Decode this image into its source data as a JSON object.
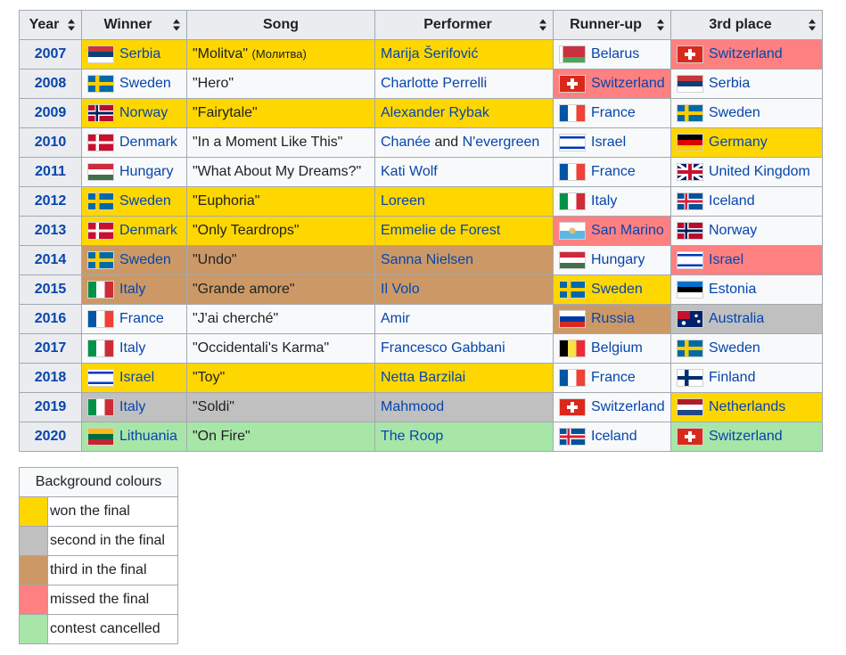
{
  "headers": [
    "Year",
    "Winner",
    "Song",
    "Performer",
    "Runner-up",
    "3rd place"
  ],
  "colors": {
    "gold": "#ffd700",
    "silver": "#c0c0c0",
    "bronze": "#cc9966",
    "missed": "#fe8080",
    "cancelled": "#a8e6a8",
    "plain": "#f8f9fa",
    "header": "#eaecf0",
    "border": "#a2a9b1",
    "link": "#0645ad"
  },
  "rows": [
    {
      "year": "2007",
      "winner": {
        "country": "Serbia",
        "flag": "serbia-flag",
        "bg": "gold"
      },
      "song": {
        "title": "\"Molitva\"",
        "extra": "(Молитва)",
        "bg": "gold"
      },
      "performer": {
        "parts": [
          "Marija Šerifović"
        ],
        "bg": "gold"
      },
      "runner_up": {
        "country": "Belarus",
        "flag": "belarus-flag",
        "bg": "plain"
      },
      "third": {
        "country": "Switzerland",
        "flag": "switzerland-flag",
        "bg": "missed"
      }
    },
    {
      "year": "2008",
      "winner": {
        "country": "Sweden",
        "flag": "sweden-flag",
        "bg": "plain"
      },
      "song": {
        "title": "\"Hero\"",
        "bg": "plain"
      },
      "performer": {
        "parts": [
          "Charlotte Perrelli"
        ],
        "bg": "plain"
      },
      "runner_up": {
        "country": "Switzerland",
        "flag": "switzerland-flag",
        "bg": "missed"
      },
      "third": {
        "country": "Serbia",
        "flag": "serbia-flag",
        "bg": "plain"
      }
    },
    {
      "year": "2009",
      "winner": {
        "country": "Norway",
        "flag": "norway-flag",
        "bg": "gold"
      },
      "song": {
        "title": "\"Fairytale\"",
        "bg": "gold"
      },
      "performer": {
        "parts": [
          "Alexander Rybak"
        ],
        "bg": "gold"
      },
      "runner_up": {
        "country": "France",
        "flag": "france-flag",
        "bg": "plain"
      },
      "third": {
        "country": "Sweden",
        "flag": "sweden-flag",
        "bg": "plain"
      }
    },
    {
      "year": "2010",
      "winner": {
        "country": "Denmark",
        "flag": "denmark-flag",
        "bg": "plain"
      },
      "song": {
        "title": "\"In a Moment Like This\"",
        "bg": "plain"
      },
      "performer": {
        "parts": [
          "Chanée",
          " and ",
          "N'evergreen"
        ],
        "bg": "plain"
      },
      "runner_up": {
        "country": "Israel",
        "flag": "israel-flag",
        "bg": "plain"
      },
      "third": {
        "country": "Germany",
        "flag": "germany-flag",
        "bg": "gold"
      }
    },
    {
      "year": "2011",
      "winner": {
        "country": "Hungary",
        "flag": "hungary-flag",
        "bg": "plain"
      },
      "song": {
        "title": "\"What About My Dreams?\"",
        "bg": "plain"
      },
      "performer": {
        "parts": [
          "Kati Wolf"
        ],
        "bg": "plain"
      },
      "runner_up": {
        "country": "France",
        "flag": "france-flag",
        "bg": "plain"
      },
      "third": {
        "country": "United Kingdom",
        "flag": "uk-flag",
        "bg": "plain"
      }
    },
    {
      "year": "2012",
      "winner": {
        "country": "Sweden",
        "flag": "sweden-flag",
        "bg": "gold"
      },
      "song": {
        "title": "\"Euphoria\"",
        "bg": "gold"
      },
      "performer": {
        "parts": [
          "Loreen"
        ],
        "bg": "gold"
      },
      "runner_up": {
        "country": "Italy",
        "flag": "italy-flag",
        "bg": "plain"
      },
      "third": {
        "country": "Iceland",
        "flag": "iceland-flag",
        "bg": "plain"
      }
    },
    {
      "year": "2013",
      "winner": {
        "country": "Denmark",
        "flag": "denmark-flag",
        "bg": "gold"
      },
      "song": {
        "title": "\"Only Teardrops\"",
        "bg": "gold"
      },
      "performer": {
        "parts": [
          "Emmelie de Forest"
        ],
        "bg": "gold"
      },
      "runner_up": {
        "country": "San Marino",
        "flag": "san-marino-flag",
        "bg": "missed"
      },
      "third": {
        "country": "Norway",
        "flag": "norway-flag",
        "bg": "plain"
      }
    },
    {
      "year": "2014",
      "winner": {
        "country": "Sweden",
        "flag": "sweden-flag",
        "bg": "bronze"
      },
      "song": {
        "title": "\"Undo\"",
        "bg": "bronze"
      },
      "performer": {
        "parts": [
          "Sanna Nielsen"
        ],
        "bg": "bronze"
      },
      "runner_up": {
        "country": "Hungary",
        "flag": "hungary-flag",
        "bg": "plain"
      },
      "third": {
        "country": "Israel",
        "flag": "israel-flag",
        "bg": "missed"
      }
    },
    {
      "year": "2015",
      "winner": {
        "country": "Italy",
        "flag": "italy-flag",
        "bg": "bronze"
      },
      "song": {
        "title": "\"Grande amore\"",
        "bg": "bronze"
      },
      "performer": {
        "parts": [
          "Il Volo"
        ],
        "bg": "bronze"
      },
      "runner_up": {
        "country": "Sweden",
        "flag": "sweden-flag",
        "bg": "gold"
      },
      "third": {
        "country": "Estonia",
        "flag": "estonia-flag",
        "bg": "plain"
      }
    },
    {
      "year": "2016",
      "winner": {
        "country": "France",
        "flag": "france-flag",
        "bg": "plain"
      },
      "song": {
        "title": "\"J'ai cherché\"",
        "bg": "plain"
      },
      "performer": {
        "parts": [
          "Amir"
        ],
        "bg": "plain"
      },
      "runner_up": {
        "country": "Russia",
        "flag": "russia-flag",
        "bg": "bronze"
      },
      "third": {
        "country": "Australia",
        "flag": "australia-flag",
        "bg": "silver"
      }
    },
    {
      "year": "2017",
      "winner": {
        "country": "Italy",
        "flag": "italy-flag",
        "bg": "plain"
      },
      "song": {
        "title": "\"Occidentali's Karma\"",
        "bg": "plain"
      },
      "performer": {
        "parts": [
          "Francesco Gabbani"
        ],
        "bg": "plain"
      },
      "runner_up": {
        "country": "Belgium",
        "flag": "belgium-flag",
        "bg": "plain"
      },
      "third": {
        "country": "Sweden",
        "flag": "sweden-flag",
        "bg": "plain"
      }
    },
    {
      "year": "2018",
      "winner": {
        "country": "Israel",
        "flag": "israel-flag",
        "bg": "gold"
      },
      "song": {
        "title": "\"Toy\"",
        "bg": "gold"
      },
      "performer": {
        "parts": [
          "Netta Barzilai"
        ],
        "bg": "gold"
      },
      "runner_up": {
        "country": "France",
        "flag": "france-flag",
        "bg": "plain"
      },
      "third": {
        "country": "Finland",
        "flag": "finland-flag",
        "bg": "plain"
      }
    },
    {
      "year": "2019",
      "winner": {
        "country": "Italy",
        "flag": "italy-flag",
        "bg": "silver"
      },
      "song": {
        "title": "\"Soldi\"",
        "bg": "silver"
      },
      "performer": {
        "parts": [
          "Mahmood"
        ],
        "bg": "silver"
      },
      "runner_up": {
        "country": "Switzerland",
        "flag": "switzerland-flag",
        "bg": "plain"
      },
      "third": {
        "country": "Netherlands",
        "flag": "netherlands-flag",
        "bg": "gold"
      }
    },
    {
      "year": "2020",
      "winner": {
        "country": "Lithuania",
        "flag": "lithuania-flag",
        "bg": "cancelled"
      },
      "song": {
        "title": "\"On Fire\"",
        "bg": "cancelled"
      },
      "performer": {
        "parts": [
          "The Roop"
        ],
        "bg": "cancelled"
      },
      "runner_up": {
        "country": "Iceland",
        "flag": "iceland-flag",
        "bg": "plain"
      },
      "third": {
        "country": "Switzerland",
        "flag": "switzerland-flag",
        "bg": "cancelled"
      }
    }
  ],
  "legend": {
    "title": "Background colours",
    "items": [
      {
        "label": "won the final",
        "color": "gold"
      },
      {
        "label": "second in the final",
        "color": "silver"
      },
      {
        "label": "third in the final",
        "color": "bronze"
      },
      {
        "label": "missed the final",
        "color": "missed"
      },
      {
        "label": "contest cancelled",
        "color": "cancelled"
      }
    ]
  }
}
